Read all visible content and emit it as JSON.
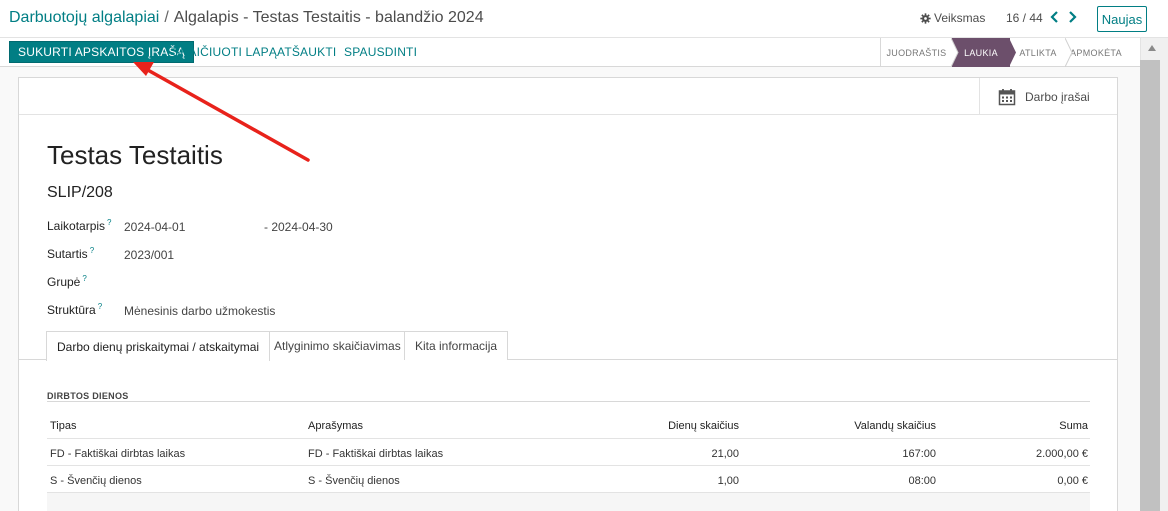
{
  "breadcrumb": {
    "parent": "Darbuotojų algalapiai",
    "separator": "/",
    "current": "Algalapis - Testas Testaitis - balandžio 2024"
  },
  "topbar": {
    "actions_label": "Veiksmas",
    "pager": "16 / 44",
    "new_label": "Naujas"
  },
  "control": {
    "primary_label": "SUKURTI APSKAITOS ĮRAŠĄ",
    "compute_label": "SKAIČIUOTI LAPĄ",
    "cancel_label": "ATŠAUKTI",
    "print_label": "SPAUSDINTI"
  },
  "status_stages": [
    {
      "label": "JUODRAŠTIS",
      "active": false
    },
    {
      "label": "LAUKIA",
      "active": true
    },
    {
      "label": "ATLIKTA",
      "active": false
    },
    {
      "label": "APMOKĖTA",
      "active": false
    }
  ],
  "smart_button": {
    "label": "Darbo įrašai",
    "icon": "calendar-icon"
  },
  "record": {
    "name": "Testas Testaitis",
    "reference": "SLIP/208",
    "period_label": "Laikotarpis",
    "period_from": "2024-04-01",
    "period_to": "- 2024-04-30",
    "contract_label": "Sutartis",
    "contract_value": "2023/001",
    "group_label": "Grupė",
    "group_value": "",
    "structure_label": "Struktūra",
    "structure_value": "Mėnesinis darbo užmokestis",
    "help_mark": "?"
  },
  "tabs": [
    {
      "label": "Darbo dienų priskaitymai / atskaitymai",
      "active": true
    },
    {
      "label": "Atlyginimo skaičiavimas",
      "active": false
    },
    {
      "label": "Kita informacija",
      "active": false
    }
  ],
  "worked_days": {
    "section_title": "DIRBTOS DIENOS",
    "columns": [
      "Tipas",
      "Aprašymas",
      "Dienų skaičius",
      "Valandų skaičius",
      "Suma"
    ],
    "rows": [
      [
        "FD - Faktiškai dirbtas laikas",
        "FD - Faktiškai dirbtas laikas",
        "21,00",
        "167:00",
        "2.000,00 €"
      ],
      [
        "S - Švenčių dienos",
        "S - Švenčių dienos",
        "1,00",
        "08:00",
        "0,00 €"
      ]
    ]
  },
  "colors": {
    "accent": "#017e84",
    "stage_active": "#6c4f6b",
    "annotation_arrow": "#e8221b"
  }
}
